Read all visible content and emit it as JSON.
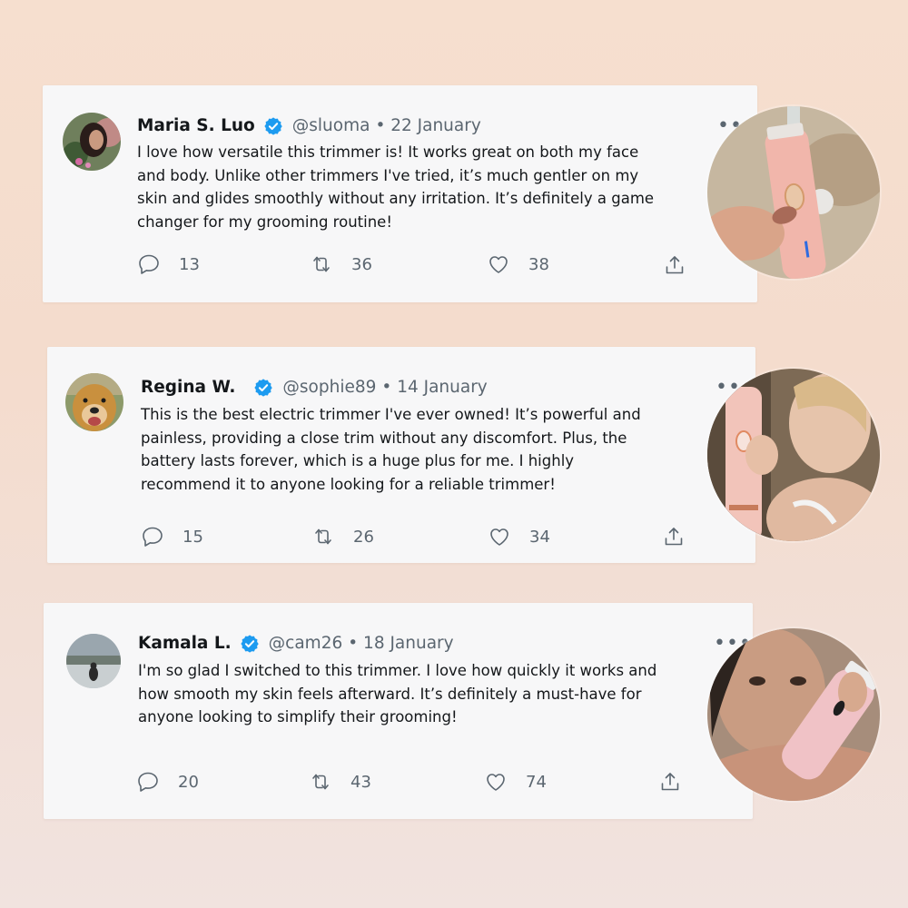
{
  "colors": {
    "verified": "#1d9bf0",
    "text": "#14171a",
    "muted": "#5b6670",
    "card": "#f7f7f8"
  },
  "icons": {
    "reply": "reply-icon",
    "retweet": "retweet-icon",
    "like": "heart-icon",
    "share": "share-icon",
    "more": "more-icon",
    "verified": "verified-badge-icon"
  },
  "tweets": [
    {
      "name": "Maria S. Luo",
      "handle": "@sluoma",
      "date": "• 22 January",
      "lines": [
        "I love how versatile this trimmer is! It works great on both my face",
        "and body. Unlike other trimmers I've tried, it’s much gentler on my",
        "skin and glides smoothly without any irritation. It’s definitely a game",
        "changer for my grooming routine!"
      ],
      "replies": "13",
      "retweets": "36",
      "likes": "38",
      "more": "•••"
    },
    {
      "name": "Regina W.",
      "handle": "@sophie89",
      "date": "• 14 January",
      "lines": [
        "This is the best electric trimmer I've ever owned! It’s powerful and",
        "painless, providing a close trim without any discomfort. Plus, the",
        "battery lasts forever, which is a huge plus for me. I highly",
        "recommend it to anyone looking for a reliable trimmer!"
      ],
      "replies": "15",
      "retweets": "26",
      "likes": "34",
      "more": "•••"
    },
    {
      "name": "Kamala L.",
      "handle": "@cam26",
      "date": "• 18 January",
      "lines": [
        "I'm so glad I switched to this trimmer. I love how quickly it works and",
        "how smooth my skin feels afterward. It’s definitely a must-have for",
        "anyone looking to simplify their grooming!"
      ],
      "replies": "20",
      "retweets": "43",
      "likes": "74",
      "more": "•••"
    }
  ]
}
